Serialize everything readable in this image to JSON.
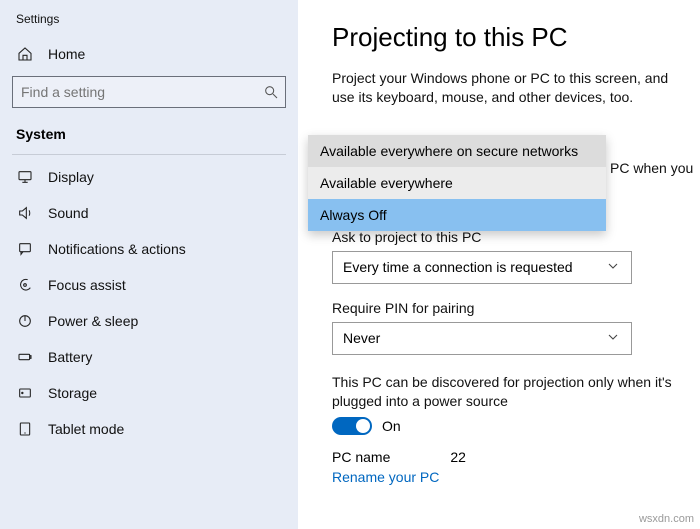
{
  "app_title": "Settings",
  "sidebar": {
    "home_label": "Home",
    "search_placeholder": "Find a setting",
    "section_label": "System",
    "items": [
      {
        "label": "Display"
      },
      {
        "label": "Sound"
      },
      {
        "label": "Notifications & actions"
      },
      {
        "label": "Focus assist"
      },
      {
        "label": "Power & sleep"
      },
      {
        "label": "Battery"
      },
      {
        "label": "Storage"
      },
      {
        "label": "Tablet mode"
      }
    ]
  },
  "page": {
    "title": "Projecting to this PC",
    "description": "Project your Windows phone or PC to this screen, and use its keyboard, mouse, and other devices, too.",
    "partial_behind_dropdown": "PC when you",
    "availability_dropdown": {
      "options": [
        "Available everywhere on secure networks",
        "Available everywhere",
        "Always Off"
      ],
      "selected": "Always Off"
    },
    "ask_label": "Ask to project to this PC",
    "ask_value": "Every time a connection is requested",
    "pin_label": "Require PIN for pairing",
    "pin_value": "Never",
    "discover_text": "This PC can be discovered for projection only when it's plugged into a power source",
    "toggle_state": "On",
    "pcname_label": "PC name",
    "pcname_value": "22",
    "rename_link": "Rename your PC"
  },
  "watermark": "wsxdn.com"
}
